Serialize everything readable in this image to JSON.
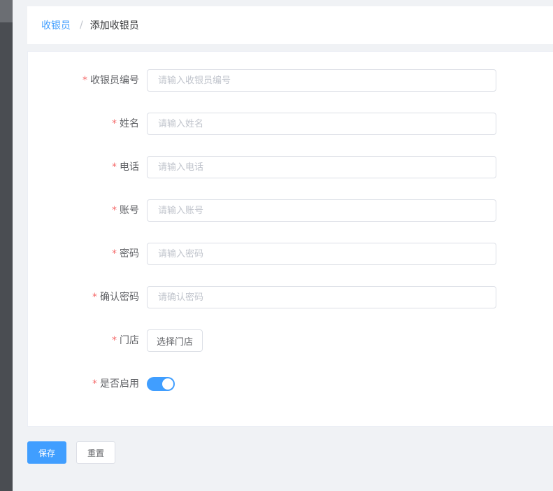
{
  "breadcrumb": {
    "parent": "收银员",
    "separator": "/",
    "current": "添加收银员"
  },
  "form": {
    "required_mark": "*",
    "fields": [
      {
        "label": "收银员编号",
        "placeholder": "请输入收银员编号"
      },
      {
        "label": "姓名",
        "placeholder": "请输入姓名"
      },
      {
        "label": "电话",
        "placeholder": "请输入电话"
      },
      {
        "label": "账号",
        "placeholder": "请输入账号"
      },
      {
        "label": "密码",
        "placeholder": "请输入密码"
      },
      {
        "label": "确认密码",
        "placeholder": "请确认密码"
      }
    ],
    "store": {
      "label": "门店",
      "button_label": "选择门店"
    },
    "enabled": {
      "label": "是否启用",
      "value": true
    }
  },
  "actions": {
    "save_label": "保存",
    "reset_label": "重置"
  },
  "colors": {
    "primary": "#409eff",
    "required": "#f56c6c"
  }
}
